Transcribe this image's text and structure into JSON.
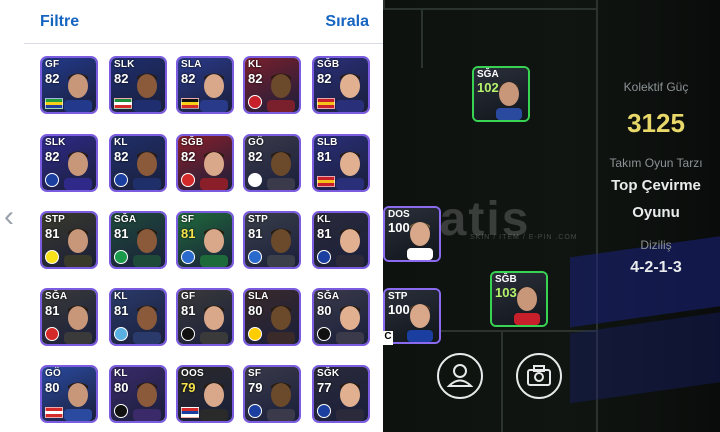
{
  "header": {
    "filter_label": "Filtre",
    "sort_label": "Sırala"
  },
  "grid_cards": [
    {
      "pos": "GF",
      "ovr": "82",
      "flag": [
        "#1f9e3a",
        "#f7d117",
        "#1f3fa0"
      ],
      "bg": "#233a8c"
    },
    {
      "pos": "SLK",
      "ovr": "82",
      "flag": [
        "#1a8c3a",
        "#ffffff",
        "#d42a2a"
      ],
      "bg": "#1e2e6e"
    },
    {
      "pos": "SLA",
      "ovr": "82",
      "flag": [
        "#111111",
        "#f7d117",
        "#d42a2a"
      ],
      "bg": "#2a3a8a"
    },
    {
      "pos": "KL",
      "ovr": "82",
      "club": "#c8202b",
      "bg": "#7a1f2c"
    },
    {
      "pos": "SĞB",
      "ovr": "82",
      "flag": [
        "#c8202b",
        "#f7c21a",
        "#c8202b"
      ],
      "bg": "#2a2f7a"
    },
    {
      "pos": "SLK",
      "ovr": "82",
      "club": "#1a3fa0",
      "bg": "#2f2a8a"
    },
    {
      "pos": "KL",
      "ovr": "82",
      "club": "#1a3fa0",
      "bg": "#1f2f6a"
    },
    {
      "pos": "SĞB",
      "ovr": "82",
      "club": "#d42a2a",
      "bg": "#8a1f2a"
    },
    {
      "pos": "GÖ",
      "ovr": "82",
      "club": "#ffffff",
      "bg": "#3a3a4a"
    },
    {
      "pos": "SLB",
      "ovr": "81",
      "flag": [
        "#c8202b",
        "#f7c21a",
        "#c8202b"
      ],
      "bg": "#2a2f7a"
    },
    {
      "pos": "STP",
      "ovr": "81",
      "club": "#f7e11a",
      "bg": "#3a3a2a"
    },
    {
      "pos": "SĞA",
      "ovr": "81",
      "club": "#1a9a4a",
      "bg": "#1f4a3a"
    },
    {
      "pos": "SF",
      "ovr": "81",
      "club": "#2a6acc",
      "bg": "#1f6a3a",
      "gold": true
    },
    {
      "pos": "STP",
      "ovr": "81",
      "club": "#2a6acc",
      "bg": "#3a3f4a"
    },
    {
      "pos": "KL",
      "ovr": "81",
      "club": "#1a3fa0",
      "bg": "#2a2a3a"
    },
    {
      "pos": "SĞA",
      "ovr": "81",
      "club": "#d42a2a",
      "bg": "#3a3a3a"
    },
    {
      "pos": "KL",
      "ovr": "81",
      "club": "#5ab0e0",
      "bg": "#2a3a6a"
    },
    {
      "pos": "GF",
      "ovr": "81",
      "club": "#111111",
      "bg": "#3a3a3a"
    },
    {
      "pos": "SLA",
      "ovr": "80",
      "club": "#ffcc00",
      "bg": "#3a2a2a"
    },
    {
      "pos": "SĞA",
      "ovr": "80",
      "club": "#111111",
      "bg": "#3a3a4a"
    },
    {
      "pos": "GÖ",
      "ovr": "80",
      "flag": [
        "#d42a2a",
        "#ffffff",
        "#d42a2a"
      ],
      "bg": "#2a4aa0"
    },
    {
      "pos": "KL",
      "ovr": "80",
      "club": "#111111",
      "bg": "#3a2a6a"
    },
    {
      "pos": "OOS",
      "ovr": "79",
      "flag": [
        "#d42a2a",
        "#1a3fa0",
        "#ffffff"
      ],
      "bg": "#2a2a2a",
      "gold": true
    },
    {
      "pos": "SF",
      "ovr": "79",
      "club": "#1a3fa0",
      "bg": "#3a3a4a"
    },
    {
      "pos": "SĞK",
      "ovr": "77",
      "club": "#1a3fa0",
      "bg": "#2a2a3a"
    }
  ],
  "pitch_cards": [
    {
      "pos": "SĞA",
      "ovr": "102",
      "green": true
    },
    {
      "pos": "DOS",
      "ovr": "100",
      "green": false
    },
    {
      "pos": "SĞB",
      "ovr": "103",
      "green": true
    },
    {
      "pos": "STP",
      "ovr": "100",
      "green": false
    }
  ],
  "stats": {
    "team_strength_label": "Kolektif Güç",
    "team_strength_value": "3125",
    "play_style_label": "Takım Oyun Tarzı",
    "play_style_value_line1": "Top Çevirme",
    "play_style_value_line2": "Oyunu",
    "formation_label": "Diziliş",
    "formation_value": "4-2-1-3"
  },
  "watermark": {
    "text": "matis",
    "sub": "SKIN / ITEM / E-PIN .COM"
  },
  "pitch_badge_letter": "C",
  "colors": {
    "accent_blue": "#1565c0",
    "strength_gold": "#e8d86a",
    "card_border": "#7b5ce0",
    "green_ovr": "#b6f26a"
  },
  "icons": {
    "back": "chevron-left-icon",
    "person": "person-icon",
    "camera": "camera-icon"
  }
}
